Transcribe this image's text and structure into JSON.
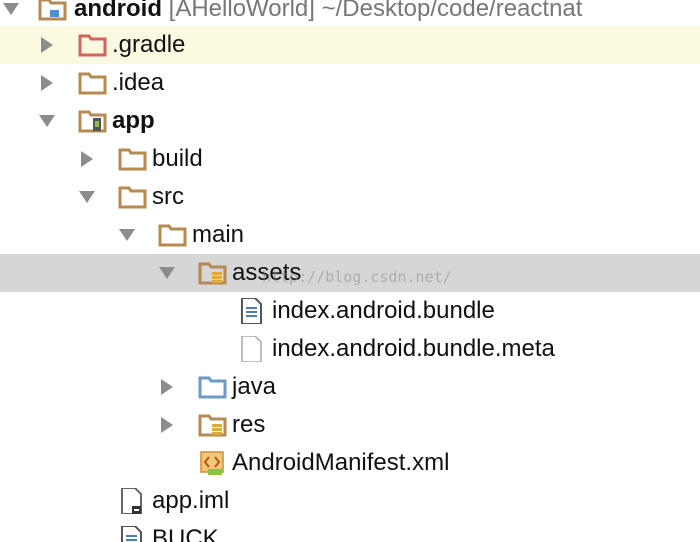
{
  "project_tree": {
    "items": [
      {
        "label": "android",
        "suffix": " [AHelloWorld]  ~/Desktop/code/reactnat",
        "bold": true,
        "icon": "module-folder-icon",
        "arrow": "expanded"
      },
      {
        "label": ".gradle",
        "icon": "excluded-folder-icon",
        "arrow": "collapsed"
      },
      {
        "label": ".idea",
        "icon": "folder-icon",
        "arrow": "collapsed"
      },
      {
        "label": "app",
        "bold": true,
        "icon": "android-module-folder-icon",
        "arrow": "expanded"
      },
      {
        "label": "build",
        "icon": "folder-icon",
        "arrow": "collapsed"
      },
      {
        "label": "src",
        "icon": "folder-icon",
        "arrow": "expanded"
      },
      {
        "label": "main",
        "icon": "folder-icon",
        "arrow": "expanded"
      },
      {
        "label": "assets",
        "icon": "resource-folder-icon",
        "arrow": "expanded"
      },
      {
        "label": "index.android.bundle",
        "icon": "text-file-icon"
      },
      {
        "label": "index.android.bundle.meta",
        "icon": "file-icon"
      },
      {
        "label": "java",
        "icon": "source-folder-icon",
        "arrow": "collapsed"
      },
      {
        "label": "res",
        "icon": "resource-folder-icon",
        "arrow": "collapsed"
      },
      {
        "label": "AndroidManifest.xml",
        "icon": "manifest-file-icon"
      },
      {
        "label": "app.iml",
        "icon": "iml-file-icon"
      },
      {
        "label": "BUCK",
        "icon": "text-file-icon"
      }
    ]
  },
  "watermark": "http://blog.csdn.net/",
  "colors": {
    "folder": "#b58b53",
    "excluded_folder": "#d0645f",
    "source_folder": "#6e9ac4",
    "selected_row": "#d6d6d6",
    "hover_row": "#fcf9e1",
    "arrow": "#8c8c8c"
  }
}
